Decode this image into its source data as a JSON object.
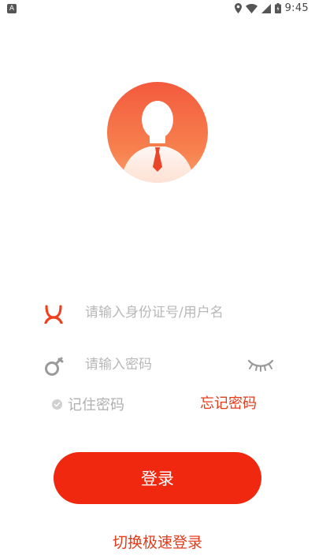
{
  "status_bar": {
    "time": "9:45",
    "left_icon": "notification-a-icon",
    "right_icons": [
      "location-icon",
      "wifi-icon",
      "signal-icon",
      "battery-icon"
    ]
  },
  "avatar": {
    "icon": "user-avatar-icon",
    "colors": {
      "top": "#f45a3e",
      "bottom": "#f9a070"
    }
  },
  "login_form": {
    "username": {
      "icon": "user-icon",
      "placeholder": "请输入身份证号/用户名",
      "value": ""
    },
    "password": {
      "icon": "lock-icon",
      "placeholder": "请输入密码",
      "value": "",
      "toggle_icon": "eye-closed-icon"
    },
    "remember_label": "记住密码",
    "forgot_label": "忘记密码",
    "submit_label": "登录",
    "switch_label": "切换极速登录"
  },
  "colors": {
    "accent": "#f02810",
    "link": "#e53a1a",
    "placeholder": "#b8b8b8"
  }
}
